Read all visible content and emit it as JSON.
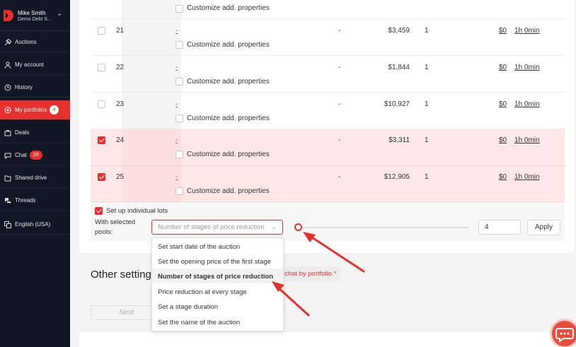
{
  "user": {
    "name": "Mike Smith",
    "org": "Demo Debt S..."
  },
  "nav": [
    {
      "label": "Auctions",
      "icon": "gavel-icon"
    },
    {
      "label": "My account",
      "icon": "user-icon"
    },
    {
      "label": "History",
      "icon": "clock-icon"
    },
    {
      "label": "My portfolios",
      "icon": "target-icon",
      "badge": "4",
      "active": true
    },
    {
      "label": "Deals",
      "icon": "briefcase-icon"
    },
    {
      "label": "Chat",
      "icon": "chat-icon",
      "badge": "29"
    },
    {
      "label": "Shared drive",
      "icon": "folder-icon"
    },
    {
      "label": "Threads",
      "icon": "threads-icon"
    },
    {
      "label": "English (USA)",
      "icon": "language-icon"
    }
  ],
  "table": {
    "top_partial_row": {
      "customize_label": "Customize add. properties"
    },
    "rows": [
      {
        "id": "21",
        "link": "-",
        "customize": "Customize add. properties",
        "dash": "-",
        "amount": "$3,459",
        "count": "1",
        "fee": "$0",
        "duration": "1h 0min",
        "checked": false
      },
      {
        "id": "22",
        "link": "-",
        "customize": "Customize add. properties",
        "dash": "-",
        "amount": "$1,844",
        "count": "1",
        "fee": "$0",
        "duration": "1h 0min",
        "checked": false
      },
      {
        "id": "23",
        "link": "-",
        "customize": "Customize add. properties",
        "dash": "-",
        "amount": "$10,927",
        "count": "1",
        "fee": "$0",
        "duration": "1h 0min",
        "checked": false
      },
      {
        "id": "24",
        "link": "-",
        "customize": "Customize add. properties",
        "dash": "-",
        "amount": "$3,311",
        "count": "1",
        "fee": "$0",
        "duration": "1h 0min",
        "checked": true
      },
      {
        "id": "25",
        "link": "-",
        "customize": "Customize add. properties",
        "dash": "-",
        "amount": "$12,905",
        "count": "1",
        "fee": "$0",
        "duration": "1h 0min",
        "checked": true
      }
    ]
  },
  "bulk": {
    "individual_lots_label": "Set up individual lots",
    "with_selected": "With selected",
    "pools": "pools:",
    "select_placeholder": "Number of stages of price reduction",
    "number_value": "4",
    "apply_label": "Apply"
  },
  "dropdown_options": [
    "Set start date of the auction",
    "Set the opening price of the first stage",
    "Number of stages of price reduction",
    "Price reduction at every stage",
    "Set a stage duration",
    "Set the name of the auction"
  ],
  "other_settings": {
    "heading": "Other settings",
    "chat_pill": "chat by portfolio *",
    "next_label": "Next"
  },
  "colors": {
    "accent": "#e6302e",
    "sidebar": "#111724",
    "selected_row": "#fde8e7"
  }
}
